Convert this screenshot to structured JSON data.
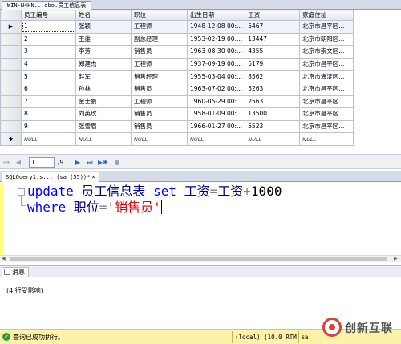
{
  "result_tab": {
    "title": "WIN-N4HN...dbo.员工信息表"
  },
  "grid": {
    "columns": [
      "员工编号",
      "姓名",
      "职位",
      "出生日期",
      "工资",
      "家庭住址"
    ],
    "current_row_indicator": "▶",
    "new_row_indicator": "✱",
    "rows": [
      [
        "1",
        "张颖",
        "工程师",
        "1948-12-08 00:...",
        "5467",
        "北京市昌平区..."
      ],
      [
        "2",
        "王维",
        "副总经理",
        "1953-02-19 00:...",
        "13447",
        "北京市朝阳区..."
      ],
      [
        "3",
        "李芳",
        "销售员",
        "1963-08-30 00:...",
        "4355",
        "北京市崇文区..."
      ],
      [
        "4",
        "郑建杰",
        "工程师",
        "1937-09-19 00:...",
        "5179",
        "北京市昌平区..."
      ],
      [
        "5",
        "赵军",
        "销售经理",
        "1955-03-04 00:...",
        "8562",
        "北京市海淀区..."
      ],
      [
        "6",
        "孙林",
        "销售员",
        "1963-07-02 00:...",
        "5263",
        "北京市昌平区..."
      ],
      [
        "7",
        "金士鹏",
        "工程师",
        "1960-05-29 00:...",
        "2563",
        "北京市昌平区..."
      ],
      [
        "8",
        "刘英玫",
        "销售员",
        "1958-01-09 00:...",
        "13500",
        "北京市昌平区..."
      ],
      [
        "9",
        "张雪眉",
        "销售员",
        "1966-01-27 00:...",
        "5523",
        "北京市昌平区..."
      ]
    ],
    "null_row": [
      "NULL",
      "NULL",
      "NULL",
      "NULL",
      "NULL",
      "NULL"
    ]
  },
  "navigator": {
    "first_icon": "first-record-icon",
    "prev_icon": "previous-record-icon",
    "position": "1",
    "of_total": "/9",
    "next_icon": "next-record-icon",
    "last_icon": "last-record-icon",
    "new_icon": "new-record-icon",
    "stop_icon": "stop-icon"
  },
  "query_tab": {
    "title": "SQLQuery1.s... (sa (55))*",
    "close": "×"
  },
  "editor": {
    "line1": {
      "kw1": "update",
      "t1": " 员工信息表 ",
      "kw2": "set",
      "t2": " 工资",
      "op1": "=",
      "t3": "工资",
      "op2": "+",
      "num": "1000"
    },
    "line2": {
      "kw1": "where",
      "t1": " 职位",
      "op1": "=",
      "str": "'销售员'"
    },
    "fold": "−"
  },
  "messages": {
    "tab_label": "消息",
    "text": "(4 行受影响)"
  },
  "status": {
    "icon": "check-icon",
    "message": "查询已成功执行。",
    "server": "(local) (10.0 RTM)",
    "user": "sa"
  },
  "watermark": {
    "text": "创新互联"
  },
  "colors": {
    "keyword": "#0000ff",
    "string": "#d60000",
    "status_bg": "#fdf3a8",
    "success": "#2f9b2f"
  }
}
